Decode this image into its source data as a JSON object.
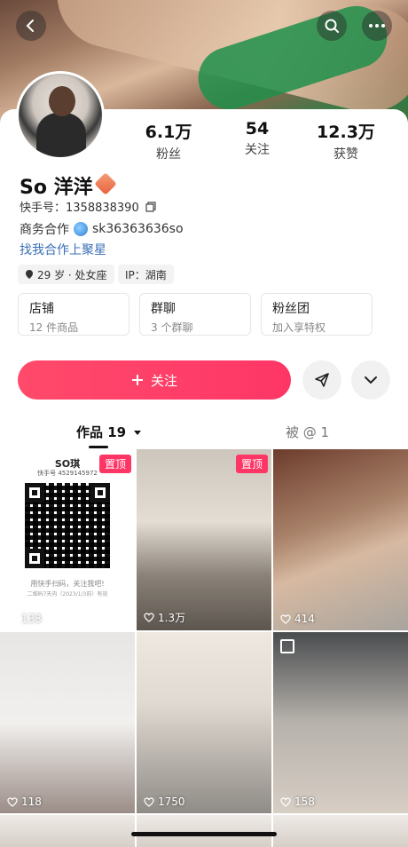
{
  "profile": {
    "name": "So 洋洋",
    "kuaishou_id": "快手号：1358838390",
    "business_label": "商务合作",
    "business_contact": "sk36363636so",
    "cooperation_link": "找我合作上聚星",
    "age_tag": "29 岁 · 处女座",
    "ip_tag": "IP：湖南"
  },
  "stats": [
    {
      "value": "6.1万",
      "label": "粉丝"
    },
    {
      "value": "54",
      "label": "关注"
    },
    {
      "value": "12.3万",
      "label": "获赞"
    }
  ],
  "info_cards": [
    {
      "title": "店铺",
      "subtitle": "12 件商品"
    },
    {
      "title": "群聊",
      "subtitle": "3 个群聊"
    },
    {
      "title": "粉丝团",
      "subtitle": "加入享特权"
    }
  ],
  "actions": {
    "follow_label": "关注",
    "follow_icon": "plus-icon"
  },
  "tabs": [
    {
      "label": "作品 19",
      "active": true
    },
    {
      "label": "被 @ 1",
      "active": false
    }
  ],
  "pinned_label": "置顶",
  "qr_card": {
    "title": "SO琪",
    "subtitle": "快手号 4529145972",
    "footer": "用快手扫码，关注我吧!",
    "footer2": "二维码7天内（2023/1/3前）有效"
  },
  "posts": [
    {
      "likes": "133",
      "pinned": true
    },
    {
      "likes": "1.3万",
      "pinned": true
    },
    {
      "likes": "414",
      "pinned": false
    },
    {
      "likes": "118",
      "pinned": false
    },
    {
      "likes": "1750",
      "pinned": false
    },
    {
      "likes": "158",
      "pinned": false
    }
  ]
}
